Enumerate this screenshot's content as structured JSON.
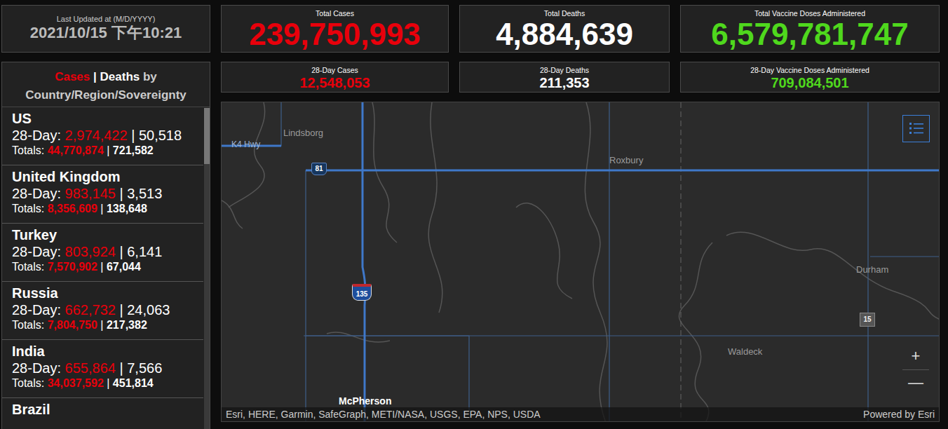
{
  "last_updated": {
    "label": "Last Updated at (M/D/YYYY)",
    "value": "2021/10/15 下午10:21"
  },
  "totals": [
    {
      "label": "Total Cases",
      "value": "239,750,993",
      "kind": "cases"
    },
    {
      "label": "Total Deaths",
      "value": "4,884,639",
      "kind": "deaths"
    },
    {
      "label": "Total Vaccine Doses Administered",
      "value": "6,579,781,747",
      "kind": "vaccines"
    }
  ],
  "period": [
    {
      "label": "28-Day Cases",
      "value": "12,548,053",
      "kind": "cases"
    },
    {
      "label": "28-Day Deaths",
      "value": "211,353",
      "kind": "deaths"
    },
    {
      "label": "28-Day Vaccine Doses Administered",
      "value": "709,084,501",
      "kind": "vaccines"
    }
  ],
  "list_header": {
    "cases": "Cases",
    "separator": "|",
    "deaths": "Deaths",
    "suffix": "by Country/Region/Sovereignty"
  },
  "countries": [
    {
      "name": "US",
      "period_label": "28-Day:",
      "period_cases": "2,974,422",
      "separator": "|",
      "period_deaths": "50,518",
      "totals_label": "Totals:",
      "total_cases": "44,770,874",
      "total_deaths": "721,582"
    },
    {
      "name": "United Kingdom",
      "period_label": "28-Day:",
      "period_cases": "983,145",
      "separator": "|",
      "period_deaths": "3,513",
      "totals_label": "Totals:",
      "total_cases": "8,356,609",
      "total_deaths": "138,648"
    },
    {
      "name": "Turkey",
      "period_label": "28-Day:",
      "period_cases": "803,924",
      "separator": "|",
      "period_deaths": "6,141",
      "totals_label": "Totals:",
      "total_cases": "7,570,902",
      "total_deaths": "67,044"
    },
    {
      "name": "Russia",
      "period_label": "28-Day:",
      "period_cases": "662,732",
      "separator": "|",
      "period_deaths": "24,063",
      "totals_label": "Totals:",
      "total_cases": "7,804,750",
      "total_deaths": "217,382"
    },
    {
      "name": "India",
      "period_label": "28-Day:",
      "period_cases": "655,864",
      "separator": "|",
      "period_deaths": "7,566",
      "totals_label": "Totals:",
      "total_cases": "34,037,592",
      "total_deaths": "451,814"
    },
    {
      "name": "Brazil"
    }
  ],
  "list_scroll": {
    "level": 0.0
  },
  "map": {
    "labels": [
      {
        "text": "Lindsborg",
        "kind": "place"
      },
      {
        "text": "K4 Hwy",
        "kind": "road"
      },
      {
        "text": "Roxbury",
        "kind": "place"
      },
      {
        "text": "Durham",
        "kind": "place"
      },
      {
        "text": "Waldeck",
        "kind": "place"
      },
      {
        "text": "McPherson",
        "kind": "major"
      }
    ],
    "shields": [
      {
        "text": "81",
        "kind": "us"
      },
      {
        "text": "135",
        "kind": "interstate"
      },
      {
        "text": "15",
        "kind": "state"
      }
    ],
    "attribution": "Esri, HERE, Garmin, SafeGraph, METI/NASA, USGS, EPA, NPS, USDA",
    "powered_by": "Powered by Esri",
    "zoom_in": "+",
    "zoom_out": "—"
  }
}
